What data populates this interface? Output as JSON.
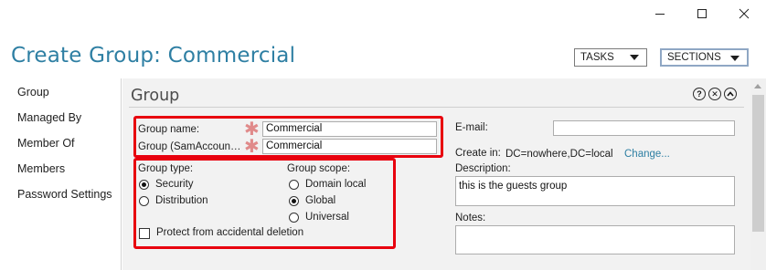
{
  "window": {
    "minimize_icon": "minimize-icon",
    "maximize_icon": "maximize-icon",
    "close_icon": "close-icon"
  },
  "header": {
    "title": "Create Group: Commercial",
    "tasks_label": "TASKS",
    "sections_label": "SECTIONS"
  },
  "sidebar": {
    "items": [
      {
        "label": "Group"
      },
      {
        "label": "Managed By"
      },
      {
        "label": "Member Of"
      },
      {
        "label": "Members"
      },
      {
        "label": "Password Settings"
      }
    ]
  },
  "panel": {
    "title": "Group",
    "help_icon": "?",
    "close_icon": "✕",
    "collapse_icon": "^",
    "group_name_label": "Group name:",
    "group_name_value": "Commercial",
    "sam_label": "Group (SamAccoun…",
    "sam_value": "Commercial",
    "required_marker": "✱",
    "group_type_label": "Group type:",
    "group_type_options": [
      {
        "label": "Security",
        "selected": true
      },
      {
        "label": "Distribution",
        "selected": false
      }
    ],
    "group_scope_label": "Group scope:",
    "group_scope_options": [
      {
        "label": "Domain local",
        "selected": false
      },
      {
        "label": "Global",
        "selected": true
      },
      {
        "label": "Universal",
        "selected": false
      }
    ],
    "protect_label": "Protect from accidental deletion",
    "protect_checked": false,
    "email_label": "E-mail:",
    "email_value": "",
    "create_in_label": "Create in:",
    "create_in_value": "DC=nowhere,DC=local",
    "change_link": "Change...",
    "description_label": "Description:",
    "description_value": "this is the guests group",
    "notes_label": "Notes:",
    "notes_value": ""
  },
  "colors": {
    "title": "#2e7fa3",
    "highlight": "#e8000e",
    "panel_bg": "#f2f2f2",
    "required": "#e08a8a"
  }
}
